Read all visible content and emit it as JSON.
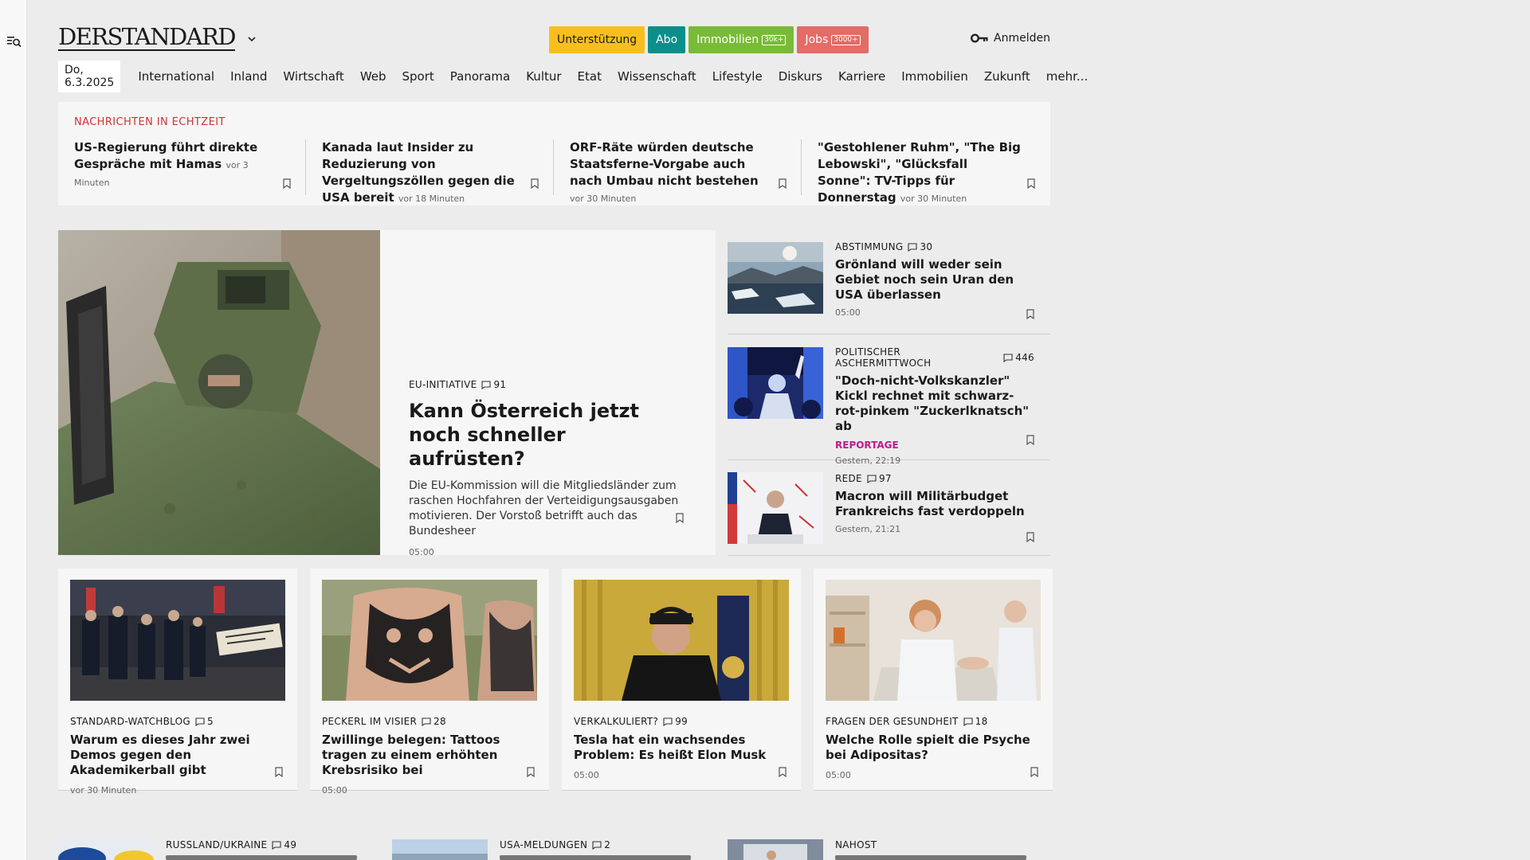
{
  "header": {
    "logo": "DERSTANDARD",
    "pills": [
      {
        "label": "Unterstützung",
        "badge": ""
      },
      {
        "label": "Abo",
        "badge": ""
      },
      {
        "label": "Immobilien",
        "badge": "30k+"
      },
      {
        "label": "Jobs",
        "badge": "3000+"
      }
    ],
    "login": "Anmelden"
  },
  "nav": {
    "date": "Do, 6.3.2025",
    "items": [
      "International",
      "Inland",
      "Wirtschaft",
      "Web",
      "Sport",
      "Panorama",
      "Kultur",
      "Etat",
      "Wissenschaft",
      "Lifestyle",
      "Diskurs",
      "Karriere",
      "Immobilien",
      "Zukunft",
      "mehr..."
    ]
  },
  "ticker": {
    "title": "NACHRICHTEN IN ECHTZEIT",
    "items": [
      {
        "title": "US-Regierung führt direkte Gespräche mit Hamas",
        "time": "vor 3 Minuten"
      },
      {
        "title": "Kanada laut Insider zu Reduzierung von Vergeltungszöllen gegen die USA bereit",
        "time": "vor 18 Minuten"
      },
      {
        "title": "ORF-Räte würden deutsche Staatsferne-Vorgabe auch nach Umbau nicht bestehen",
        "time": "vor 30 Minuten"
      },
      {
        "title": "\"Gestohlener Ruhm\", \"The Big Lebowski\", \"Glücksfall Sonne\": TV-Tipps für Donnerstag",
        "time": "vor 30 Minuten"
      }
    ]
  },
  "hero": {
    "kicker": "EU-INITIATIVE",
    "comments": "91",
    "title": "Kann Österreich jetzt noch schneller aufrüsten?",
    "lede": "Die EU-Kommission will die Mitgliedsländer zum raschen Hochfahren der Verteidigungsausgaben motivieren. Der Vorstoß betrifft auch das Bundesheer",
    "time": "05:00"
  },
  "side": [
    {
      "kicker": "ABSTIMMUNG",
      "comments": "30",
      "title": "Grönland will weder sein Gebiet noch sein Uran den USA überlassen",
      "label": "",
      "time": "05:00"
    },
    {
      "kicker": "POLITISCHER ASCHERMITTWOCH",
      "comments": "446",
      "title": "\"Doch-nicht-Volkskanzler\" Kickl rechnet mit schwarz-rot-pinkem \"Zuckerlknatsch\" ab",
      "label": "REPORTAGE",
      "time": "Gestern, 22:19"
    },
    {
      "kicker": "REDE",
      "comments": "97",
      "title": "Macron will Militärbudget Frankreichs fast verdoppeln",
      "label": "",
      "time": "Gestern, 21:21"
    }
  ],
  "row": [
    {
      "kicker": "STANDARD-WATCHBLOG",
      "comments": "5",
      "title": "Warum es dieses Jahr zwei Demos gegen den Akademikerball gibt",
      "time": "vor 30 Minuten"
    },
    {
      "kicker": "PECKERL IM VISIER",
      "comments": "28",
      "title": "Zwillinge belegen: Tattoos tragen zu einem erhöhten Krebsrisiko bei",
      "time": "05:00"
    },
    {
      "kicker": "VERKALKULIERT?",
      "comments": "99",
      "title": "Tesla hat ein wachsendes Problem: Es heißt Elon Musk",
      "time": "05:00"
    },
    {
      "kicker": "FRAGEN DER GESUNDHEIT",
      "comments": "18",
      "title": "Welche Rolle spielt die Psyche bei Adipositas?",
      "time": "05:00"
    }
  ],
  "bottom": [
    {
      "kicker": "RUSSLAND/UKRAINE",
      "comments": "49"
    },
    {
      "kicker": "USA-MELDUNGEN",
      "comments": "2"
    },
    {
      "kicker": "NAHOST",
      "comments": ""
    }
  ]
}
